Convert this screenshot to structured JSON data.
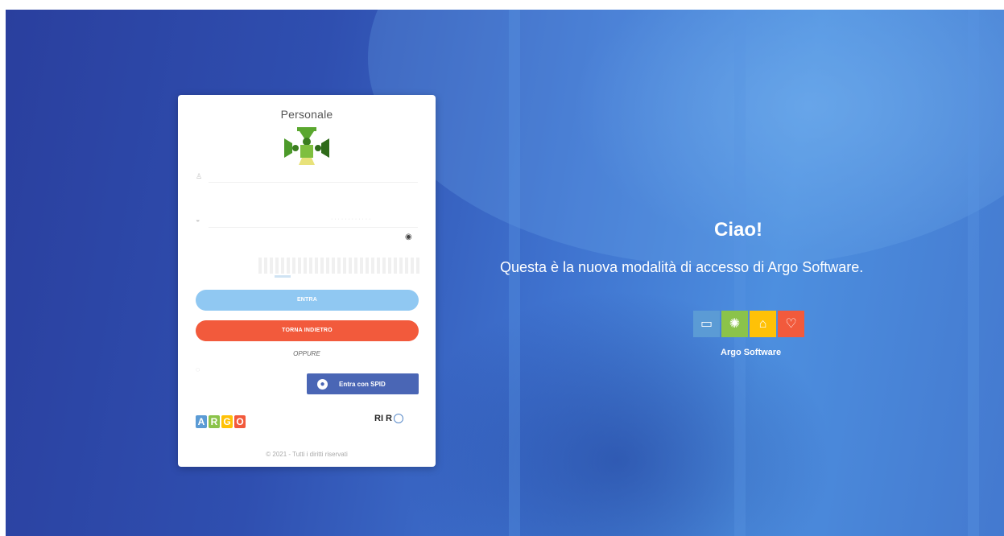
{
  "login_card": {
    "title": "Personale",
    "username_icon": "user-icon",
    "password_icon": "lock-icon",
    "password_placeholder": "· · · · · · · · · · · ·",
    "show_password_icon": "eye-icon",
    "captcha_icon": "captcha-icon",
    "enter_button": "ENTRA",
    "back_button": "TORNA INDIETRO",
    "or_label": "OPPURE",
    "spid_button": "Entra con SPID",
    "spid_icon": "spid-icon",
    "footer": "© 2021 - Tutti i diritti riservati",
    "argo_logo": [
      "A",
      "R",
      "G",
      "O"
    ],
    "argo_logo_colors": [
      "#5b9bd5",
      "#8bc34a",
      "#ffc107",
      "#f25a3c"
    ],
    "partner_logo": "RI R"
  },
  "hero": {
    "greeting": "Ciao!",
    "message": "Questa è la nuova modalità di accesso di Argo Software.",
    "brand_name": "Argo Software",
    "brand_tile_colors": [
      "#5b9bd5",
      "#8bc34a",
      "#ffc107",
      "#f25a3c"
    ],
    "brand_tile_icons": [
      "monitor-icon",
      "lightbulb-icon",
      "house-icon",
      "heart-icon"
    ]
  },
  "colors": {
    "background_primary": "#2f4fb0",
    "enter_button": "#90c8f2",
    "back_button": "#f25a3c",
    "spid_button": "#4a66b5"
  }
}
